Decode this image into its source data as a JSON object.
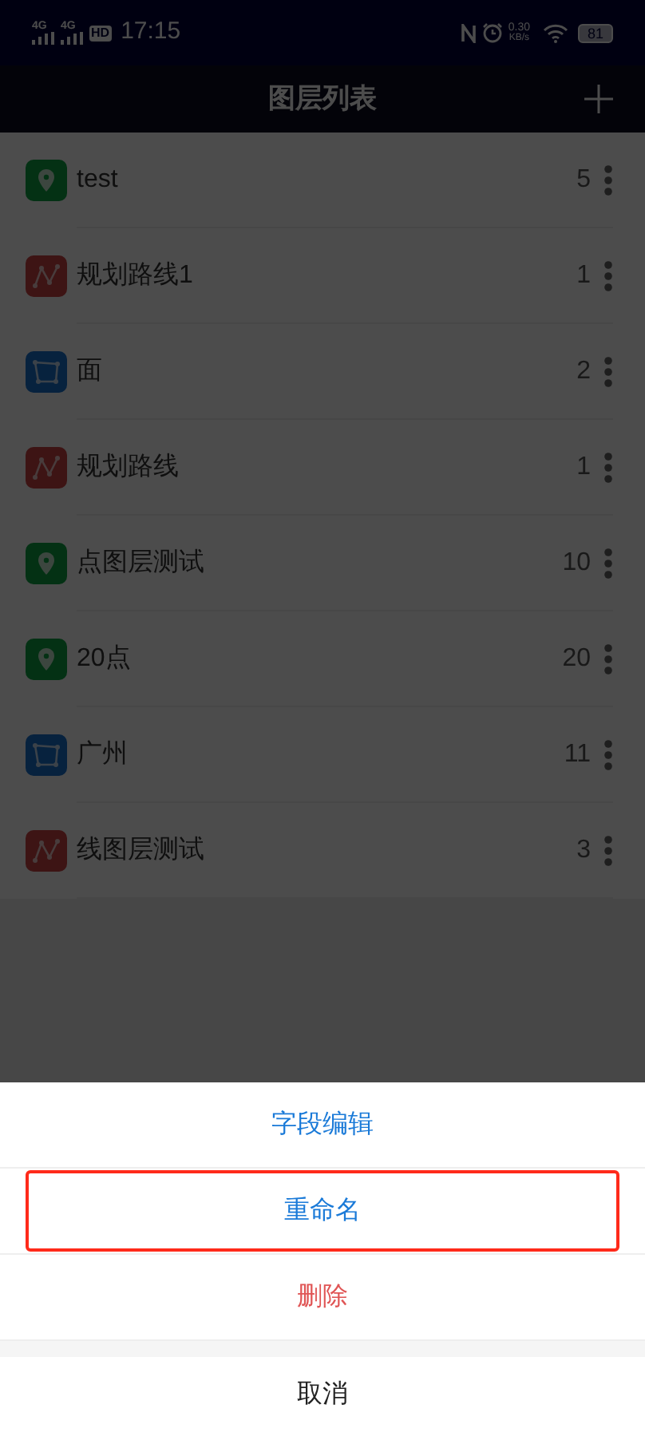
{
  "status_bar": {
    "signal_1": "4G",
    "signal_2": "4G",
    "hd": "HD",
    "time": "17:15",
    "speed_value": "0.30",
    "speed_unit": "KB/s",
    "battery": "81"
  },
  "header": {
    "title": "图层列表"
  },
  "layers": [
    {
      "kind": "point",
      "name": "test",
      "count": "5"
    },
    {
      "kind": "line",
      "name": "规划路线1",
      "count": "1"
    },
    {
      "kind": "polygon",
      "name": "面",
      "count": "2"
    },
    {
      "kind": "line",
      "name": "规划路线",
      "count": "1"
    },
    {
      "kind": "point",
      "name": "点图层测试",
      "count": "10"
    },
    {
      "kind": "point",
      "name": "20点",
      "count": "20"
    },
    {
      "kind": "polygon",
      "name": "广州",
      "count": "11"
    },
    {
      "kind": "line",
      "name": "线图层测试",
      "count": "3"
    }
  ],
  "action_sheet": {
    "actions": [
      {
        "kind": "normal",
        "label": "字段编辑",
        "highlighted": false
      },
      {
        "kind": "normal",
        "label": "重命名",
        "highlighted": true
      },
      {
        "kind": "danger",
        "label": "删除",
        "highlighted": false
      }
    ],
    "cancel": "取消"
  }
}
